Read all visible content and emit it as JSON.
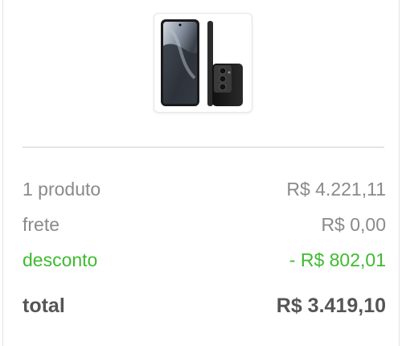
{
  "product": {
    "image_icon": "samsung-galaxy-phone-image"
  },
  "summary": {
    "items_label": "1 produto",
    "items_value": "R$ 4.221,11",
    "shipping_label": "frete",
    "shipping_value": "R$ 0,00",
    "discount_label": "desconto",
    "discount_value": "- R$ 802,01",
    "total_label": "total",
    "total_value": "R$ 3.419,10"
  },
  "colors": {
    "discount": "#3dbb2f",
    "label": "#8a8a8a",
    "total": "#555555"
  }
}
